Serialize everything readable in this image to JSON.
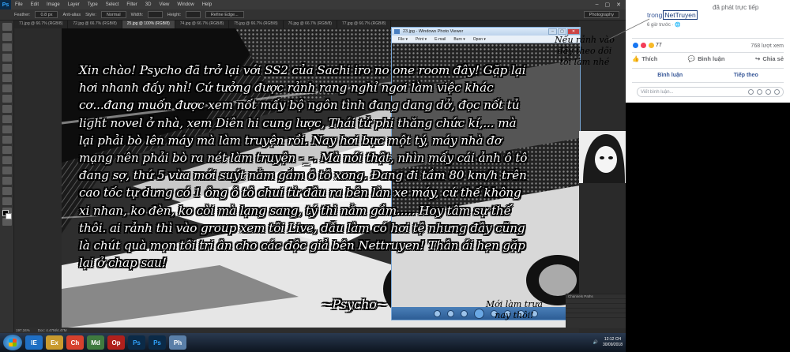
{
  "photoshop": {
    "logo": "Ps",
    "menu": [
      "File",
      "Edit",
      "Image",
      "Layer",
      "Type",
      "Select",
      "Filter",
      "3D",
      "View",
      "Window",
      "Help"
    ],
    "options": {
      "feather_label": "Feather:",
      "feather_value": "0.8 px",
      "antialias": "Anti-alias",
      "style_label": "Style:",
      "style_value": "Normal",
      "width_label": "Width:",
      "height_label": "Height:",
      "refine": "Refine Edge...",
      "workspace": "Photography"
    },
    "tabs": [
      "71.jpg @ 66.7% (RGB/8)",
      "72.jpg @ 66.7% (RGB/8)",
      "25.jpg @ 100% (RGB/8)",
      "74.jpg @ 66.7% (RGB/8)",
      "75.jpg @ 66.7% (RGB/8)",
      "76.jpg @ 66.7% (RGB/8)",
      "77.jpg @ 66.7% (RGB/8)"
    ],
    "status_zoom": "197.34%",
    "status_doc": "Doc: 4.47M/4.47M",
    "layers_panel": [
      "Channels  Paths",
      "",
      "",
      "",
      ""
    ]
  },
  "photo_viewer": {
    "title": "23.jpg - Windows Photo Viewer",
    "menu": [
      "File ▾",
      "Print ▾",
      "E-mail",
      "Burn ▾",
      "Open ▾"
    ]
  },
  "story": {
    "text": "Xin chào! Psycho đã trở lại với SS2 của Sachi iro no one room đây! Gặp lại hơi nhanh đấy nhỉ! Cứ tưởng được rảnh rang nghỉ ngơi làm việc khác cơ...đang muốn được xem nốt mấy bộ ngôn tình đang dang dở, đọc nốt tủ light novel ở nhà, xem Diên hi cung lược, Thái tử phi thăng chức kí,... mà lại phải bò lên máy mà làm truyện rồi. Nay hơi bực một tý, máy nhà đơ mạng nên phải bò ra nét làm truyện -_-. Mà nói thật, nhìn mấy cái ảnh ô tô đang sợ, thứ 5 vừa mới suýt nằm gầm ô tô xong. Đang đi tầm 80 km/h trên cao tốc tự dưng có 1 ông ô tô chui từ đâu ra bên làn xe máy, cứ thế không xi nhan, ko đèn, ko còi mà lạng sang, tý thì nằm gầm..... Hoy tâm sự thế thôi. ai rảnh thì vào group xem tôi Live, dẫu làm có hơi tệ nhưng đây cũng là chút quà mọn tôi tri ân cho các độc giả bên Nettruyen! Thân ái hẹn gặp lại ở chap sau!",
    "signature": "~Psycho~"
  },
  "notes": {
    "top_right": "Nếu rảnh vào đây theo dõi tôi làm nhé",
    "bottom": "Mới làm trưa nay thôi!"
  },
  "taskbar": {
    "apps": [
      "IE",
      "Ex",
      "Ch",
      "Md",
      "Op",
      "Ps",
      "Ps",
      "Ph"
    ],
    "time": "12:12 CH",
    "date": "30/09/2018"
  },
  "facebook": {
    "posted_status": "đã phát trực tiếp",
    "page_prefix": "trong",
    "page_name": "NetTruyen",
    "time_ago": "6 giờ trước · ",
    "reaction_count": "77",
    "views": "768 lượt xem",
    "actions": {
      "like": "Thích",
      "comment": "Bình luận",
      "share": "Chia sẻ"
    },
    "sort": {
      "comments": "Bình luận",
      "next": "Tiếp theo"
    },
    "comment_placeholder": "Viết bình luận...",
    "colors": {
      "like": "#1877f2",
      "love": "#f33e58",
      "haha": "#f7b928"
    }
  }
}
